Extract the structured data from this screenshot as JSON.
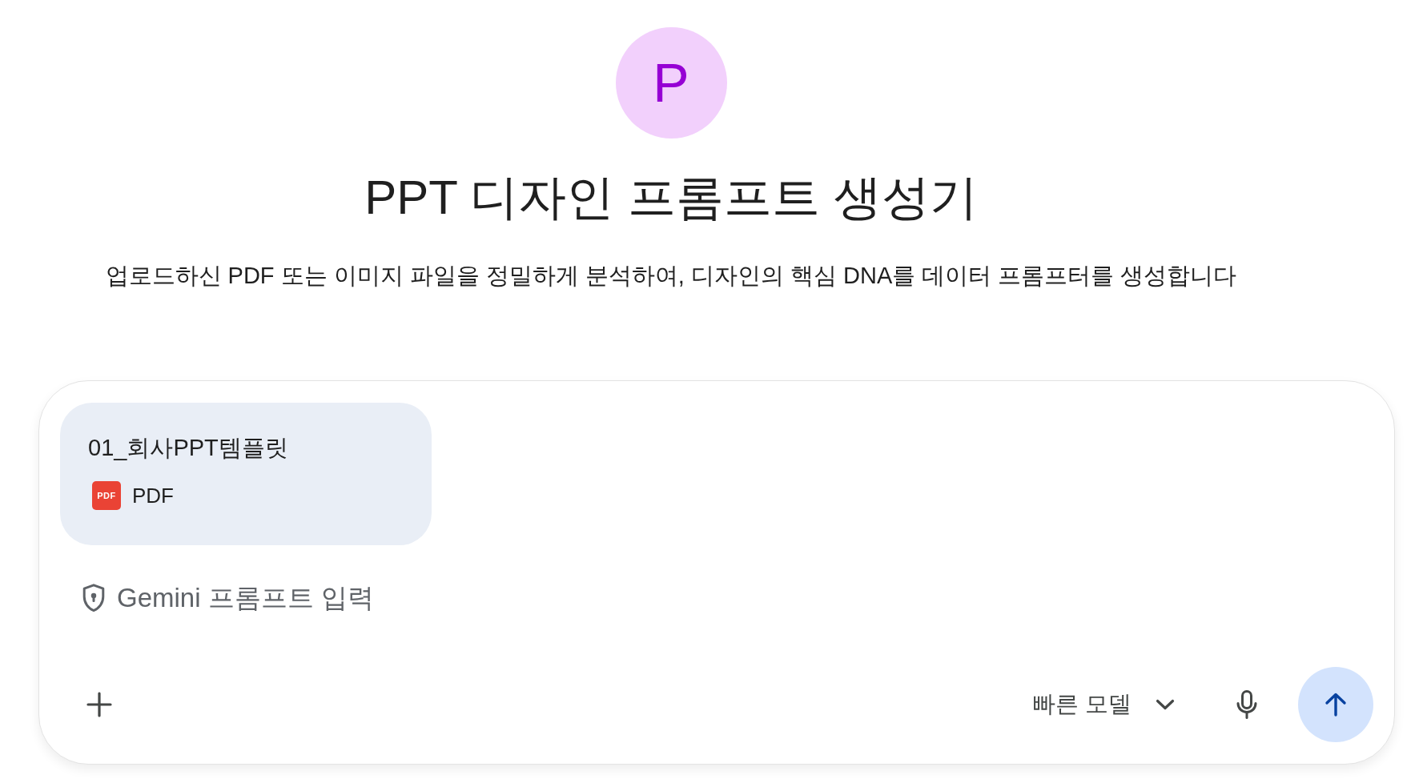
{
  "header": {
    "avatar_letter": "P",
    "title": "PPT 디자인 프롬프트 생성기",
    "description": "업로드하신 PDF 또는 이미지 파일을 정밀하게 분석하여, 디자인의 핵심 DNA를 데이터 프롬프터를 생성합니다"
  },
  "composer": {
    "attachments": [
      {
        "name": "01_회사PPT템플릿",
        "badge": "PDF",
        "type_label": "PDF"
      }
    ],
    "input": {
      "placeholder": "Gemini 프롬프트 입력"
    },
    "model_selector": {
      "label": "빠른 모델"
    }
  }
}
